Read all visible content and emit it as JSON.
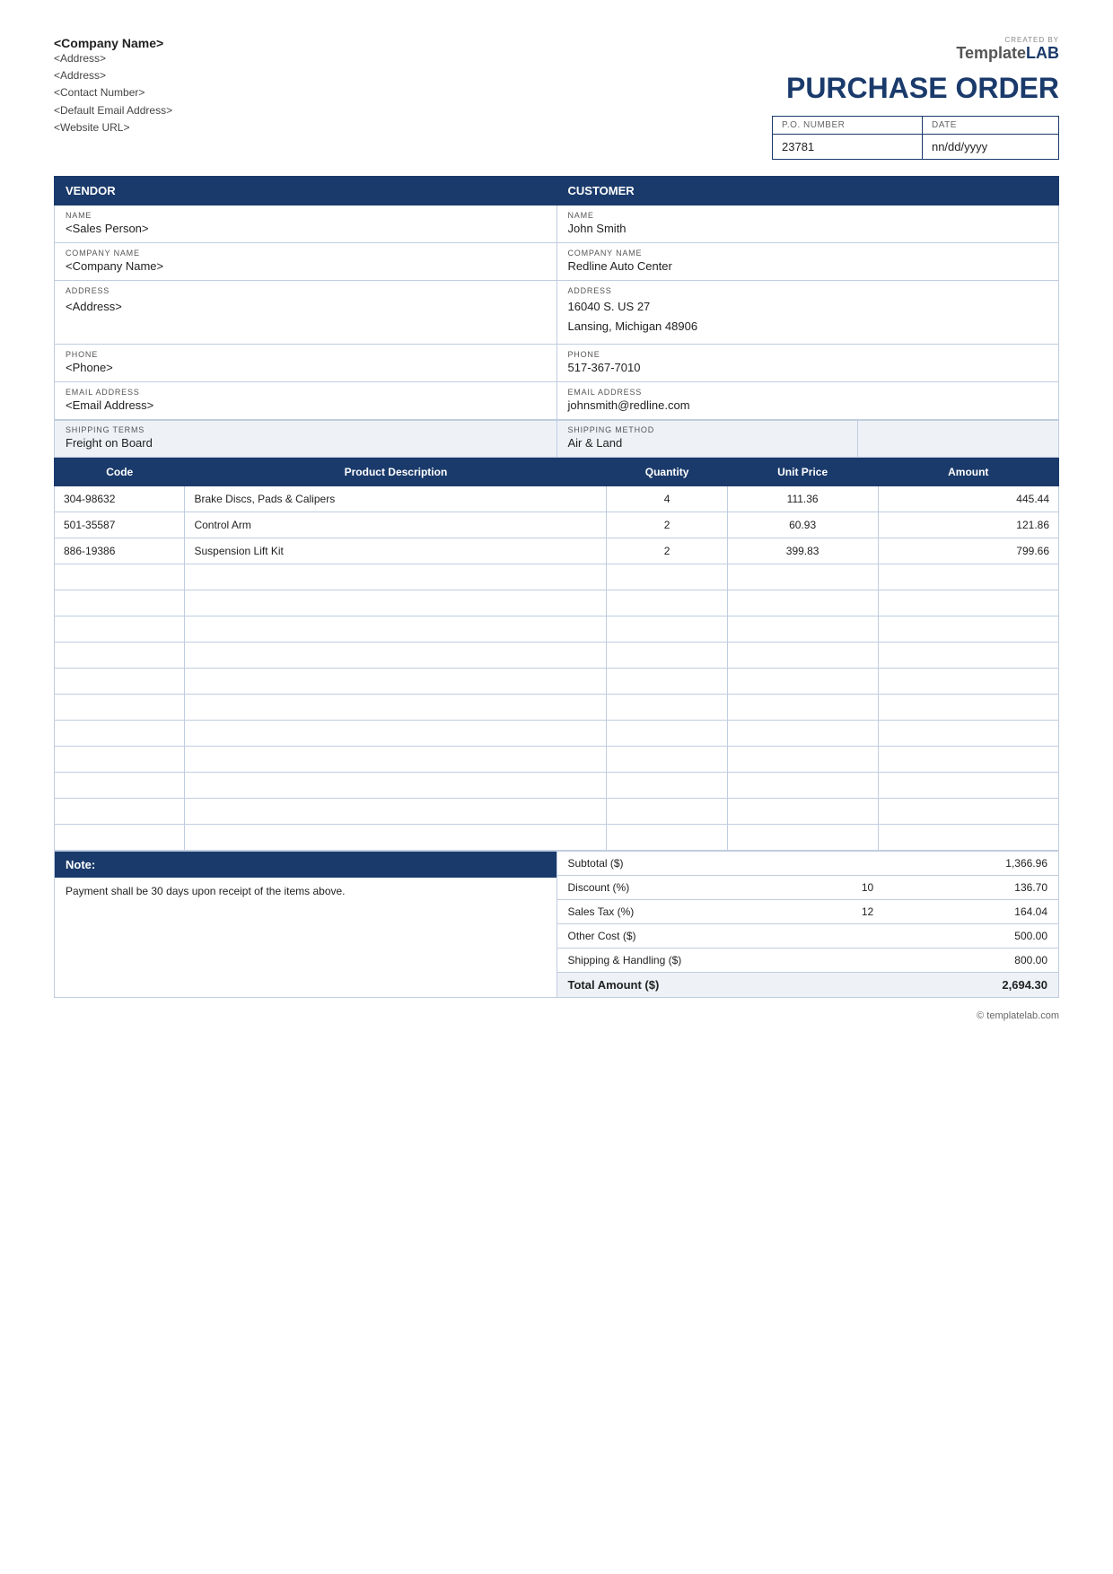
{
  "logo": {
    "created_by": "CREATED BY",
    "brand_template": "Template",
    "brand_lab": "LAB"
  },
  "title": "PURCHASE ORDER",
  "company": {
    "name": "<Company Name>",
    "address1": "<Address>",
    "address2": "<Address>",
    "contact": "<Contact Number>",
    "email": "<Default Email Address>",
    "website": "<Website URL>"
  },
  "po_number": {
    "label": "P.O. NUMBER",
    "value": "23781"
  },
  "date": {
    "label": "DATE",
    "value": "nn/dd/yyyy"
  },
  "vendor": {
    "section_label": "VENDOR",
    "name_label": "NAME",
    "name_value": "<Sales Person>",
    "company_label": "COMPANY NAME",
    "company_value": "<Company Name>",
    "address_label": "ADDRESS",
    "address_value": "<Address>",
    "phone_label": "PHONE",
    "phone_value": "<Phone>",
    "email_label": "EMAIL ADDRESS",
    "email_value": "<Email Address>"
  },
  "customer": {
    "section_label": "CUSTOMER",
    "name_label": "NAME",
    "name_value": "John Smith",
    "company_label": "COMPANY NAME",
    "company_value": "Redline Auto Center",
    "address_label": "ADDRESS",
    "address_value": "16040 S. US 27\nLansing, Michigan 48906",
    "phone_label": "PHONE",
    "phone_value": "517-367-7010",
    "email_label": "EMAIL ADDRESS",
    "email_value": "johnsmith@redline.com"
  },
  "shipping": {
    "terms_label": "SHIPPING TERMS",
    "terms_value": "Freight on Board",
    "method_label": "SHIPPING METHOD",
    "method_value": "Air & Land"
  },
  "products": {
    "col_code": "Code",
    "col_description": "Product Description",
    "col_quantity": "Quantity",
    "col_unit_price": "Unit Price",
    "col_amount": "Amount",
    "items": [
      {
        "code": "304-98632",
        "description": "Brake Discs, Pads & Calipers",
        "quantity": "4",
        "unit_price": "111.36",
        "amount": "445.44"
      },
      {
        "code": "501-35587",
        "description": "Control Arm",
        "quantity": "2",
        "unit_price": "60.93",
        "amount": "121.86"
      },
      {
        "code": "886-19386",
        "description": "Suspension Lift Kit",
        "quantity": "2",
        "unit_price": "399.83",
        "amount": "799.66"
      }
    ],
    "empty_rows": 11
  },
  "note": {
    "label": "Note:",
    "value": "Payment shall be 30 days upon receipt of the items above."
  },
  "totals": {
    "subtotal_label": "Subtotal ($)",
    "subtotal_value": "1,366.96",
    "discount_label": "Discount (%)",
    "discount_pct": "10",
    "discount_value": "136.70",
    "tax_label": "Sales Tax (%)",
    "tax_pct": "12",
    "tax_value": "164.04",
    "other_label": "Other Cost ($)",
    "other_value": "500.00",
    "shipping_label": "Shipping & Handling ($)",
    "shipping_value": "800.00",
    "total_label": "Total Amount ($)",
    "total_value": "2,694.30"
  },
  "footer": {
    "copyright": "© templatelab.com"
  }
}
